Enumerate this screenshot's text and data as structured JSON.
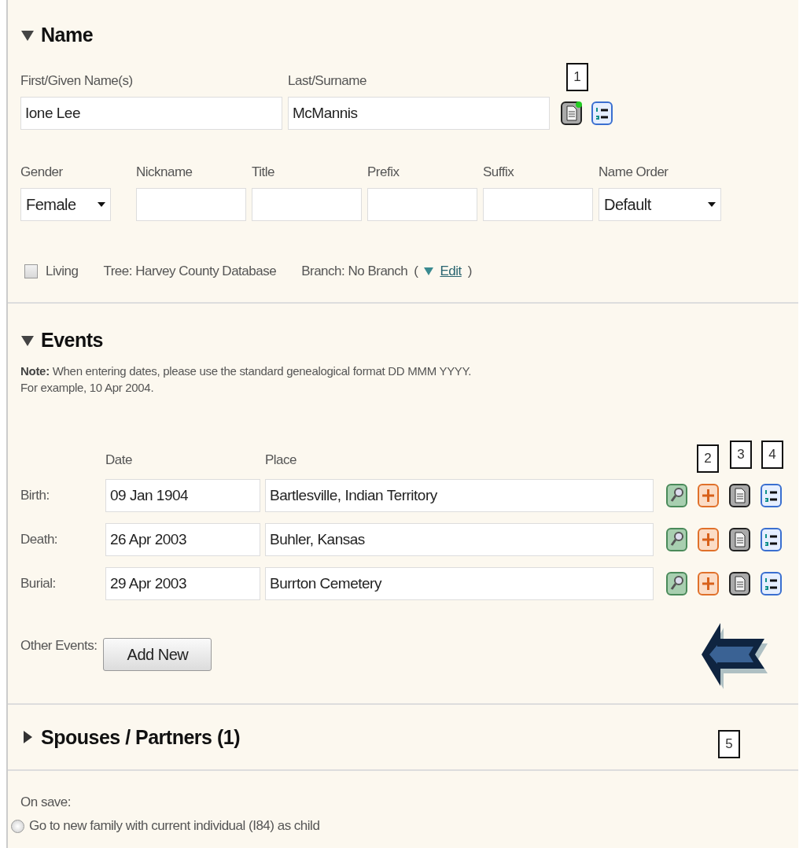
{
  "name_section": {
    "title": "Name",
    "expanded": true,
    "callout": "1",
    "fields": [
      {
        "label": "First/Given Name(s)",
        "value": "Ione Lee"
      },
      {
        "label": "Last/Surname",
        "value": "McMannis"
      }
    ],
    "notes_present": true,
    "details": [
      {
        "label": "Gender",
        "kind": "select",
        "value": "Female"
      },
      {
        "label": "Nickname",
        "kind": "text"
      },
      {
        "label": "Title",
        "kind": "text"
      },
      {
        "label": "Prefix",
        "kind": "text"
      },
      {
        "label": "Suffix",
        "kind": "text"
      },
      {
        "label": "Name Order",
        "kind": "select",
        "value": "Default"
      }
    ],
    "living": {
      "label": "Living",
      "checked": false
    },
    "tree": "Tree: Harvey County Database",
    "branch": "Branch: No Branch",
    "branch_open": "(",
    "branch_edit": "Edit",
    "branch_close": ")"
  },
  "events": {
    "title": "Events",
    "expanded": true,
    "note_lines": [
      "**Note:** When entering dates, please use the standard genealogical format DD MMM YYYY.",
      "For example, 10 Apr 2004."
    ],
    "columns": [
      "Date",
      "Place"
    ],
    "callouts": [
      "2",
      "3",
      "4"
    ],
    "rows": [
      {
        "label": "Birth:",
        "date": "09 Jan 1904",
        "place": "Bartlesville, Indian Territory"
      },
      {
        "label": "Death:",
        "date": "26 Apr 2003",
        "place": "Buhler, Kansas"
      },
      {
        "label": "Burial:",
        "date": "29 Apr 2003",
        "place": "Burrton Cemetery"
      }
    ],
    "other_label": "Other Events:",
    "add_button": "Add New"
  },
  "spouses": {
    "title": "Spouses / Partners (1)",
    "expanded": false,
    "callout": "5"
  },
  "on_save": {
    "label": "On save:",
    "options": [
      {
        "label": "Go to new family with current individual (I84) as child",
        "selected": false
      }
    ]
  }
}
